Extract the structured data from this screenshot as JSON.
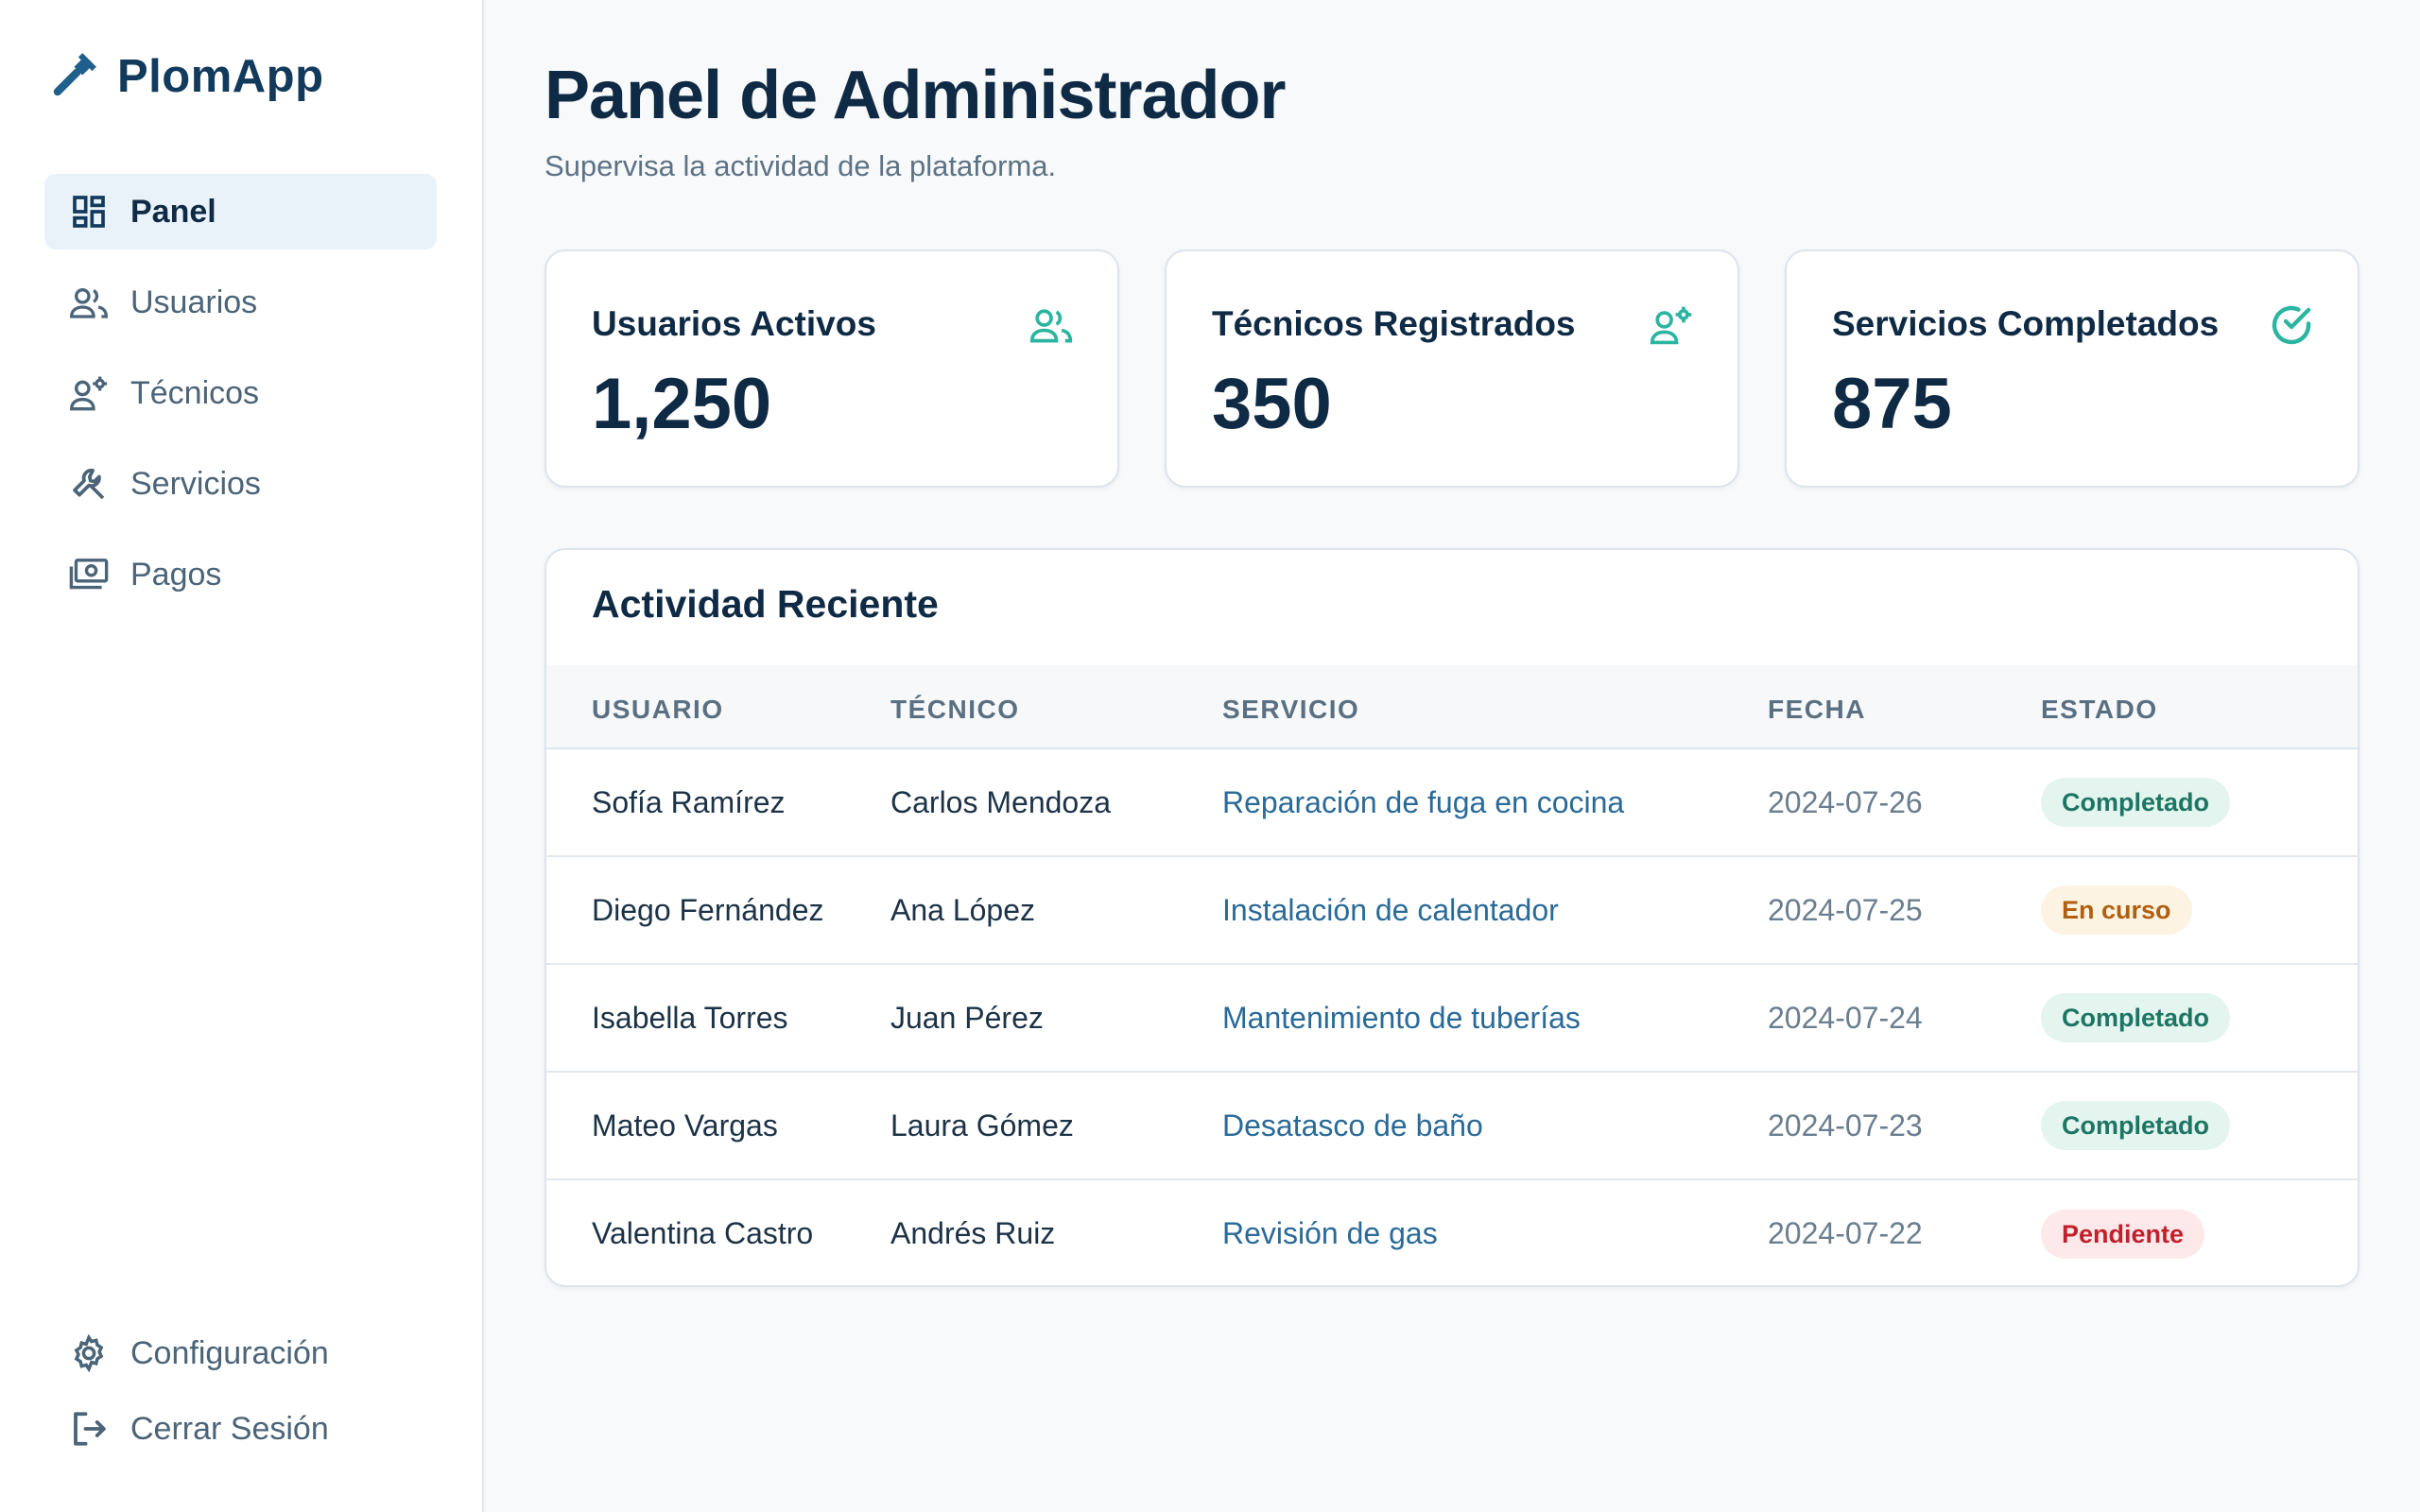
{
  "app": {
    "name": "PlomApp",
    "icon": "wrench-icon",
    "brand_color": "#1f5f8b"
  },
  "sidebar": {
    "items": [
      {
        "label": "Panel",
        "icon": "dashboard-icon",
        "active": true
      },
      {
        "label": "Usuarios",
        "icon": "users-icon",
        "active": false
      },
      {
        "label": "Técnicos",
        "icon": "technician-icon",
        "active": false
      },
      {
        "label": "Servicios",
        "icon": "wrench-icon",
        "active": false
      },
      {
        "label": "Pagos",
        "icon": "payments-icon",
        "active": false
      }
    ],
    "bottom_items": [
      {
        "label": "Configuración",
        "icon": "gear-icon"
      },
      {
        "label": "Cerrar Sesión",
        "icon": "logout-icon"
      }
    ]
  },
  "header": {
    "title": "Panel de Administrador",
    "subtitle": "Supervisa la actividad de la plataforma."
  },
  "stats": [
    {
      "label": "Usuarios Activos",
      "value": "1,250",
      "icon": "users-icon"
    },
    {
      "label": "Técnicos Registrados",
      "value": "350",
      "icon": "technician-icon"
    },
    {
      "label": "Servicios Completados",
      "value": "875",
      "icon": "check-circle-icon"
    }
  ],
  "activity": {
    "title": "Actividad Reciente",
    "columns": [
      "USUARIO",
      "TÉCNICO",
      "SERVICIO",
      "FECHA",
      "ESTADO"
    ],
    "rows": [
      {
        "user": "Sofía Ramírez",
        "tech": "Carlos Mendoza",
        "service": "Reparación de fuga en cocina",
        "date": "2024-07-26",
        "status": "Completado",
        "status_kind": "completed"
      },
      {
        "user": "Diego Fernández",
        "tech": "Ana López",
        "service": "Instalación de calentador",
        "date": "2024-07-25",
        "status": "En curso",
        "status_kind": "progress"
      },
      {
        "user": "Isabella Torres",
        "tech": "Juan Pérez",
        "service": "Mantenimiento de tuberías",
        "date": "2024-07-24",
        "status": "Completado",
        "status_kind": "completed"
      },
      {
        "user": "Mateo Vargas",
        "tech": "Laura Gómez",
        "service": "Desatasco de baño",
        "date": "2024-07-23",
        "status": "Completado",
        "status_kind": "completed"
      },
      {
        "user": "Valentina Castro",
        "tech": "Andrés Ruiz",
        "service": "Revisión de gas",
        "date": "2024-07-22",
        "status": "Pendiente",
        "status_kind": "pending"
      }
    ]
  },
  "colors": {
    "accent_teal": "#2bb5a0",
    "completed_bg": "#e4f4ef",
    "completed_fg": "#1d7563",
    "progress_bg": "#fdf3e2",
    "progress_fg": "#b15f0f",
    "pending_bg": "#fde9ea",
    "pending_fg": "#c0212c"
  }
}
